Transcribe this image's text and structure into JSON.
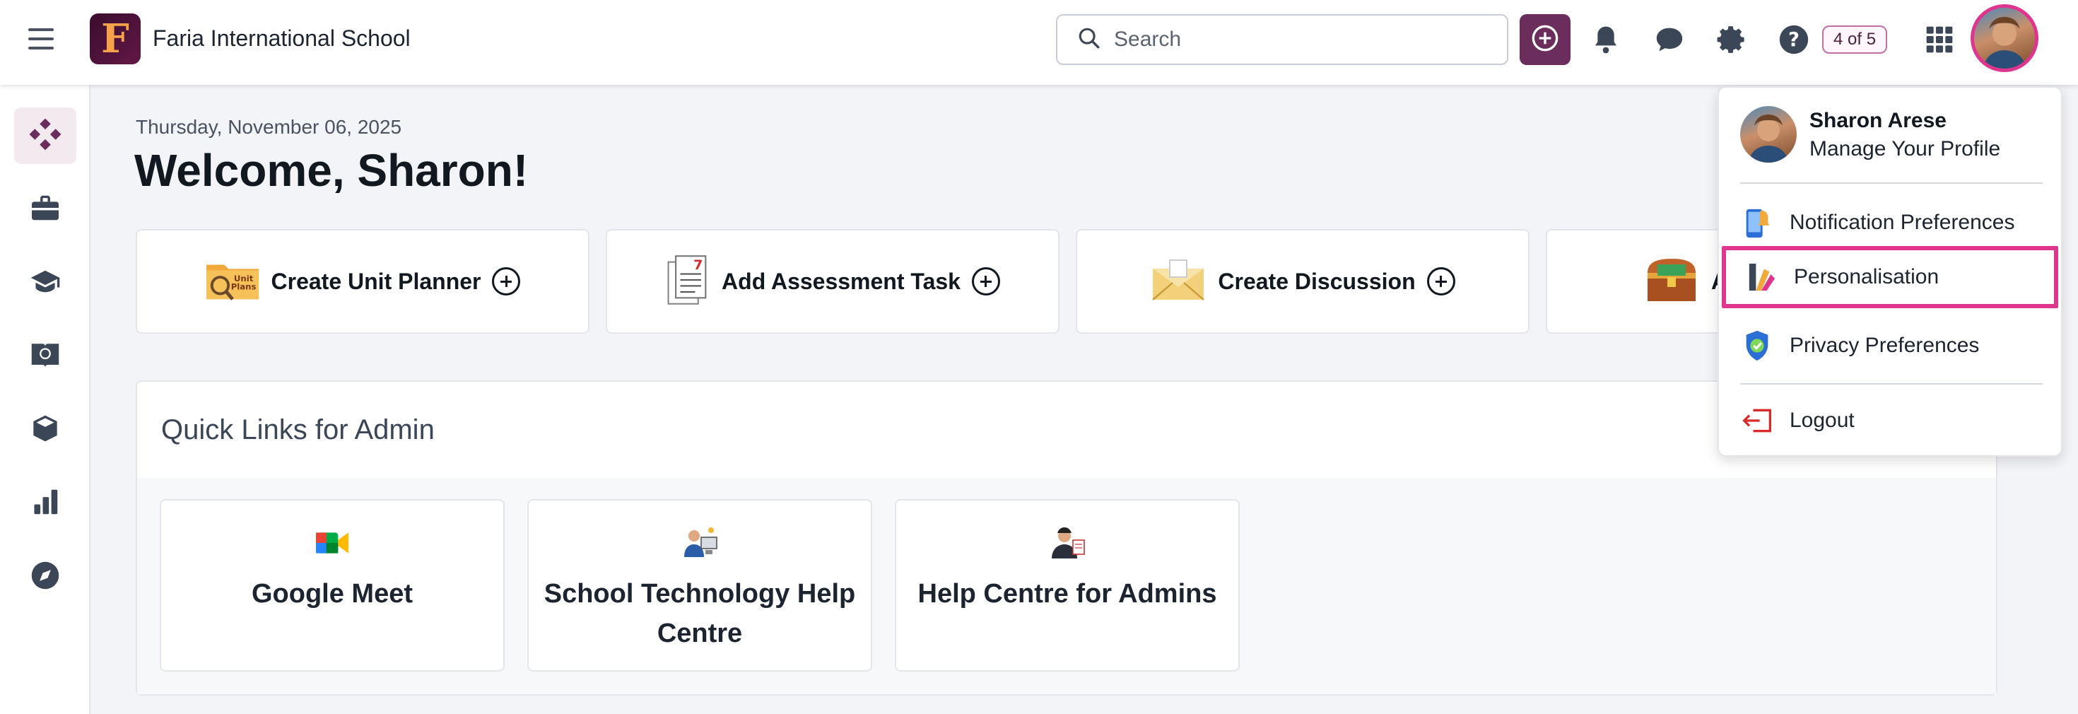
{
  "header": {
    "app_name": "Faria International School",
    "logo_letter": "F",
    "search_placeholder": "Search",
    "help_progress": "4 of 5"
  },
  "sidebar": {
    "items": [
      {
        "icon": "diamond-icon",
        "active": true
      },
      {
        "icon": "briefcase-icon",
        "active": false
      },
      {
        "icon": "graduation-cap-icon",
        "active": false
      },
      {
        "icon": "book-globe-icon",
        "active": false
      },
      {
        "icon": "cube-icon",
        "active": false
      },
      {
        "icon": "bar-chart-icon",
        "active": false
      },
      {
        "icon": "compass-icon",
        "active": false
      }
    ]
  },
  "main": {
    "date": "Thursday, November 06, 2025",
    "welcome": "Welcome, Sharon!",
    "actions": [
      {
        "label": "Create Unit Planner",
        "icon": "unit-plans-folder-icon"
      },
      {
        "label": "Add Assessment Task",
        "icon": "assessment-document-icon"
      },
      {
        "label": "Create Discussion",
        "icon": "envelope-icon"
      },
      {
        "label": "A",
        "icon": "treasure-chest-icon"
      }
    ],
    "quick_links": {
      "title": "Quick Links for Admin",
      "items": [
        {
          "label": "Google Meet",
          "icon": "google-meet-icon"
        },
        {
          "label": "School Technology Help Centre",
          "icon": "tech-support-icon"
        },
        {
          "label": "Help Centre for Admins",
          "icon": "admin-help-icon"
        }
      ]
    }
  },
  "profile_menu": {
    "name": "Sharon Arese",
    "manage": "Manage Your Profile",
    "items": [
      {
        "label": "Notification Preferences",
        "icon": "phone-notification-icon"
      },
      {
        "label": "Personalisation",
        "icon": "paint-brush-icon",
        "highlighted": true
      },
      {
        "label": "Privacy Preferences",
        "icon": "shield-check-icon"
      },
      {
        "label": "Logout",
        "icon": "logout-icon"
      }
    ]
  },
  "colors": {
    "brand": "#6b2d5c",
    "highlight": "#e0358f"
  }
}
